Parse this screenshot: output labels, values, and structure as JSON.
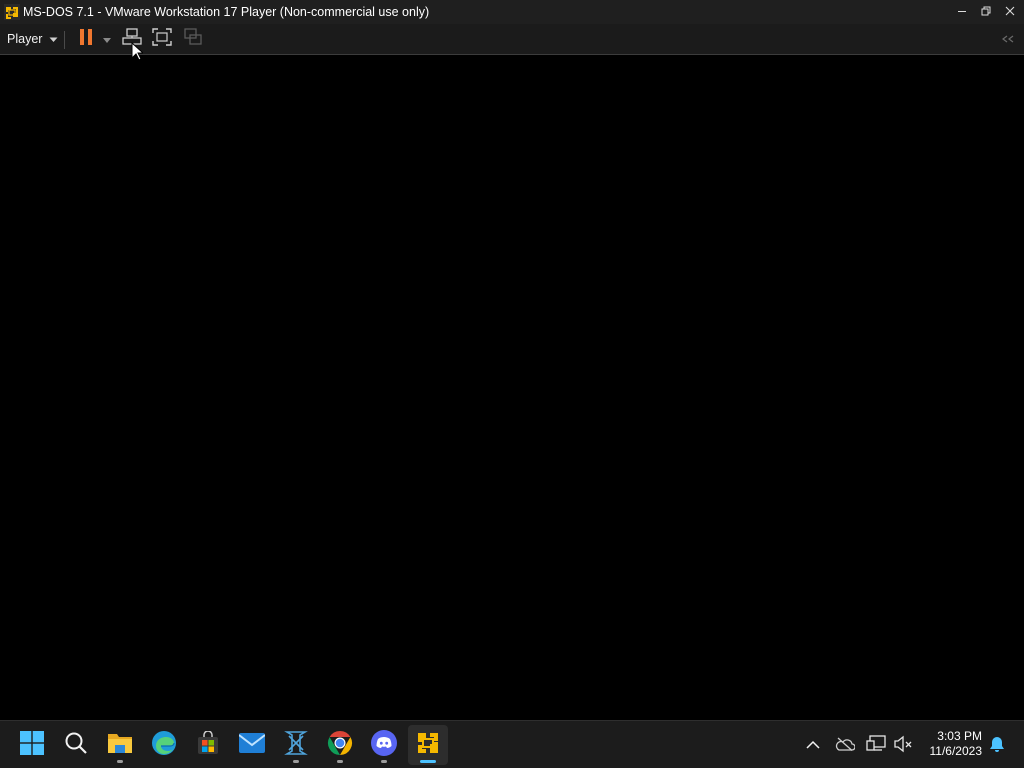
{
  "window": {
    "title": "MS-DOS 7.1 - VMware Workstation 17 Player (Non-commercial use only)",
    "controls": [
      "minimize-icon",
      "restore-icon",
      "close-icon"
    ]
  },
  "toolbar": {
    "player_menu_label": "Player",
    "buttons": [
      "pause-icon",
      "pause-dropdown-icon",
      "send-ctrl-alt-del-icon",
      "full-screen-icon",
      "unity-icon",
      "collapse-toolbar-icon"
    ]
  },
  "colors": {
    "titlebar_bg": "#1f1f1f",
    "toolbar_bg": "#1b1b1b",
    "pause_accent": "#f0772f",
    "taskbar_bg": "#1c1c1c",
    "active_indicator": "#4cc2ff",
    "vm_screen_bg": "#000000"
  },
  "taskbar": {
    "apps": [
      {
        "name": "start-icon",
        "running": false,
        "active": false
      },
      {
        "name": "search-icon",
        "running": false,
        "active": false
      },
      {
        "name": "file-explorer-icon",
        "running": true,
        "active": false
      },
      {
        "name": "edge-icon",
        "running": false,
        "active": false
      },
      {
        "name": "microsoft-store-icon",
        "running": false,
        "active": false
      },
      {
        "name": "mail-icon",
        "running": false,
        "active": false
      },
      {
        "name": "xampp-icon",
        "running": true,
        "active": false
      },
      {
        "name": "chrome-icon",
        "running": true,
        "active": false
      },
      {
        "name": "discord-icon",
        "running": true,
        "active": false
      },
      {
        "name": "vmware-player-icon",
        "running": true,
        "active": true
      }
    ],
    "tray": [
      "show-hidden-icons-icon",
      "onedrive-icon",
      "network-icon",
      "volume-muted-icon"
    ],
    "time": "3:03 PM",
    "date": "11/6/2023",
    "notification_icon": "bell-icon"
  }
}
